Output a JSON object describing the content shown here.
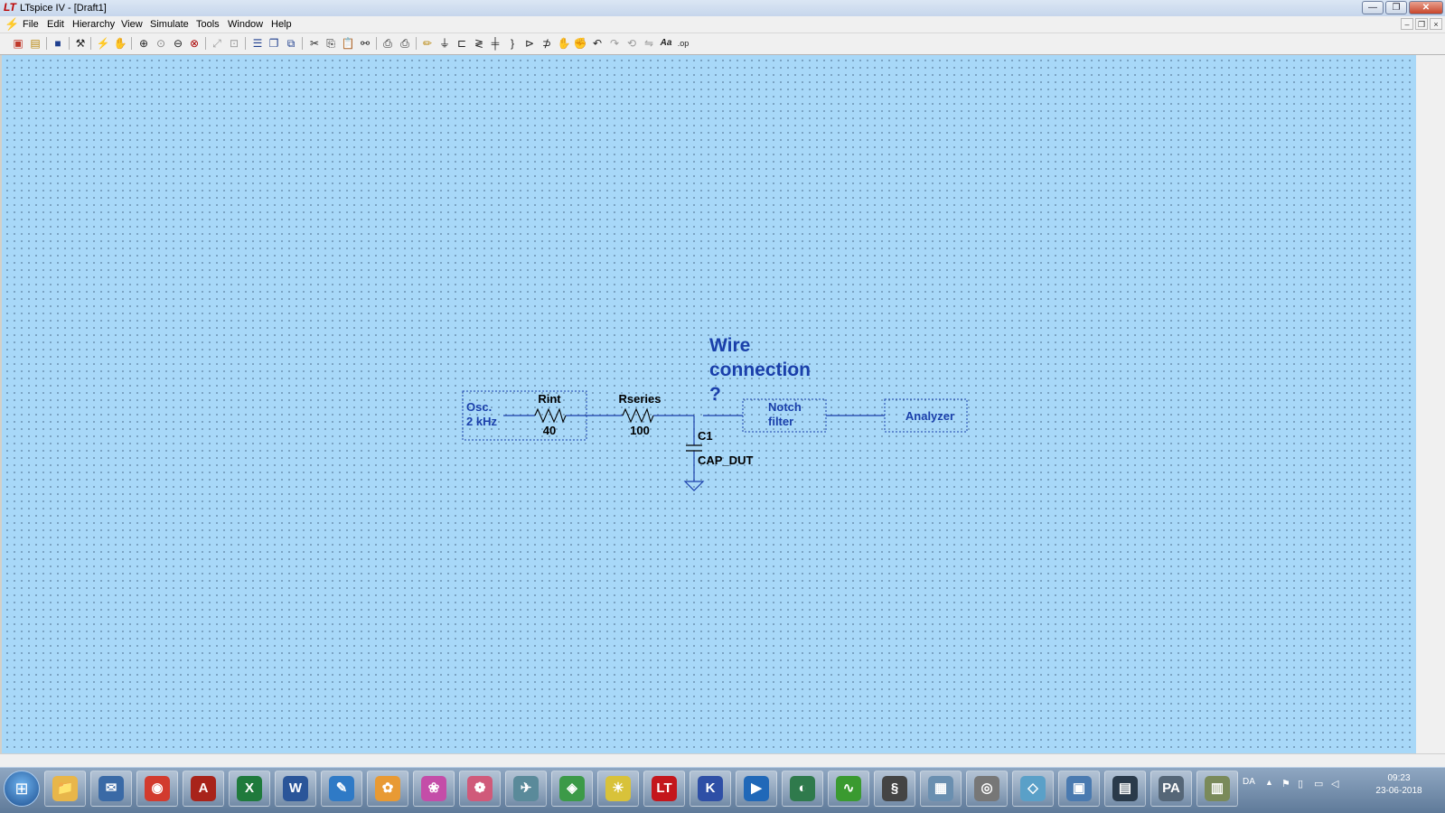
{
  "window": {
    "title": "LTspice IV - [Draft1]",
    "buttons": {
      "minimize": "—",
      "maximize": "❐",
      "close": "✕"
    }
  },
  "menu": {
    "items": [
      "File",
      "Edit",
      "Hierarchy",
      "View",
      "Simulate",
      "Tools",
      "Window",
      "Help"
    ],
    "mdi_buttons": {
      "minimize": "–",
      "restore": "❐",
      "close": "×"
    }
  },
  "toolbar": {
    "icons": [
      "new-schematic-icon",
      "open-icon",
      "save-icon",
      "control-panel-icon",
      "run-icon",
      "halt-icon",
      "zoom-in-icon",
      "zoom-pan-icon",
      "zoom-out-icon",
      "zoom-fit-icon",
      "autoscale-icon",
      "view-icon",
      "tile-horizontal-icon",
      "cascade-icon",
      "close-all-icon",
      "cut-icon",
      "copy-icon",
      "paste-icon",
      "find-icon",
      "print-setup-icon",
      "print-icon",
      "draw-wire-icon",
      "ground-icon",
      "label-net-icon",
      "resistor-icon",
      "capacitor-icon",
      "inductor-icon",
      "diode-icon",
      "component-icon",
      "move-icon",
      "drag-icon",
      "undo-icon",
      "redo-icon",
      "rotate-icon",
      "mirror-icon",
      "text-icon",
      "spice-directive-icon"
    ]
  },
  "schematic": {
    "annotation": {
      "line1": "Wire",
      "line2": "connection",
      "line3": "?"
    },
    "oscillator": {
      "line1": "Osc.",
      "line2": "2 kHz"
    },
    "rint": {
      "name": "Rint",
      "value": "40"
    },
    "rseries": {
      "name": "Rseries",
      "value": "100"
    },
    "c1": {
      "name": "C1",
      "value": "CAP_DUT"
    },
    "notch": {
      "line1": "Notch",
      "line2": "filter"
    },
    "analyzer": {
      "label": "Analyzer"
    },
    "colors": {
      "canvas": "#a8d8f8",
      "wire": "#1a3faa",
      "label": "#1a3faa",
      "component": "#000000"
    }
  },
  "taskbar": {
    "apps": [
      {
        "name": "explorer",
        "glyph": "📁",
        "color": "#e8b64a"
      },
      {
        "name": "thunderbird",
        "glyph": "✉",
        "color": "#3a6aa6"
      },
      {
        "name": "chrome",
        "glyph": "◉",
        "color": "#d23b2e"
      },
      {
        "name": "acrobat",
        "glyph": "A",
        "color": "#a8231a"
      },
      {
        "name": "excel",
        "glyph": "X",
        "color": "#1f7a3c"
      },
      {
        "name": "word",
        "glyph": "W",
        "color": "#2a5599"
      },
      {
        "name": "pen-tool",
        "glyph": "✎",
        "color": "#2f7ac6"
      },
      {
        "name": "flower-app",
        "glyph": "✿",
        "color": "#e89a34"
      },
      {
        "name": "orchid-app",
        "glyph": "❀",
        "color": "#c44da8"
      },
      {
        "name": "lily-app",
        "glyph": "❁",
        "color": "#d05a7a"
      },
      {
        "name": "satellite-app",
        "glyph": "✈",
        "color": "#5a8a9a"
      },
      {
        "name": "board-app",
        "glyph": "◈",
        "color": "#3c9a48"
      },
      {
        "name": "bulb-app",
        "glyph": "☀",
        "color": "#d8c23a"
      },
      {
        "name": "ltspice",
        "glyph": "LT",
        "color": "#c4161c"
      },
      {
        "name": "kicad",
        "glyph": "K",
        "color": "#2e4fa6"
      },
      {
        "name": "media-app",
        "glyph": "▶",
        "color": "#2068b8"
      },
      {
        "name": "green-app",
        "glyph": "◐",
        "color": "#2f7a4c"
      },
      {
        "name": "signal-app",
        "glyph": "∿",
        "color": "#3a9a30"
      },
      {
        "name": "coil-app",
        "glyph": "§",
        "color": "#444444"
      },
      {
        "name": "calculator",
        "glyph": "▦",
        "color": "#6a8fb0"
      },
      {
        "name": "disk-app",
        "glyph": "◎",
        "color": "#777777"
      },
      {
        "name": "eraser-app",
        "glyph": "◇",
        "color": "#5aa0c8"
      },
      {
        "name": "monitor-app",
        "glyph": "▣",
        "color": "#4a7ab0"
      },
      {
        "name": "scope-app",
        "glyph": "▤",
        "color": "#2a3a4a"
      },
      {
        "name": "pa-app",
        "glyph": "PA",
        "color": "#556677"
      },
      {
        "name": "building-app",
        "glyph": "▥",
        "color": "#7a8a5a"
      }
    ],
    "tray": {
      "language": "DA",
      "expand": "▲",
      "time": "09:23",
      "date": "23-06-2018"
    }
  }
}
